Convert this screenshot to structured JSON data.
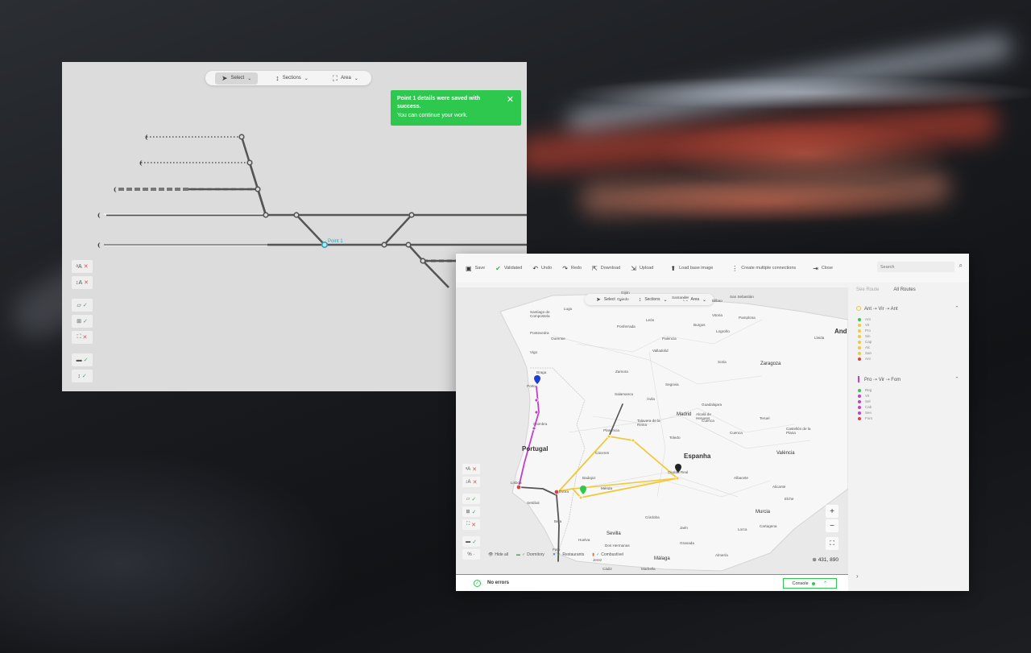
{
  "back": {
    "modes": [
      {
        "label": "Select",
        "icon": "cursor-icon"
      },
      {
        "label": "Sections",
        "icon": "section-icon"
      },
      {
        "label": "Area",
        "icon": "crop-icon"
      }
    ],
    "toast": {
      "title": "Point 1 details were saved with success.",
      "subtitle": "You can continue your work.",
      "close": "✕"
    },
    "point_label": "Point 1"
  },
  "front": {
    "toolbar": {
      "save": "Save",
      "validated": "Validated",
      "undo": "Undo",
      "redo": "Redo",
      "download": "Download",
      "upload": "Upload",
      "load_base_image": "Load base image",
      "create_multiple": "Create multiple connections",
      "close": "Close",
      "search_placeholder": "Search"
    },
    "modes": [
      {
        "label": "Select"
      },
      {
        "label": "Sections"
      },
      {
        "label": "Area"
      }
    ],
    "countries": [
      "Portugal",
      "Espanha",
      "And"
    ],
    "cities": [
      "Santiago de Compostela",
      "Lugo",
      "Ourense",
      "Pontevedra",
      "Vigo",
      "Braga",
      "Porto",
      "Coimbra",
      "Lisboa",
      "Setúbal",
      "Évora",
      "Beja",
      "Faro",
      "Badajoz",
      "Cáceres",
      "Salamanca",
      "Plasencia",
      "Madrid",
      "Toledo",
      "Ciudad Real",
      "Zamora",
      "Valladolid",
      "Palencia",
      "León",
      "Burgos",
      "Logroño",
      "Pamplona",
      "Vitoria",
      "Bilbao",
      "San Sebastián",
      "Santander",
      "Oviedo",
      "Gijón",
      "Ávila",
      "Segovia",
      "Soria",
      "Zaragoza",
      "Lleida",
      "Teruel",
      "Cuenca",
      "Guadalajara",
      "València",
      "Castellón de la Plana",
      "Albacete",
      "Alicante",
      "Murcia",
      "Cartagena",
      "Jaén",
      "Córdoba",
      "Sevilla",
      "Huelva",
      "Granada",
      "Málaga",
      "Almería",
      "Cádiz",
      "Marbella",
      "Dos Hermanas",
      "Mérida",
      "Cuenca",
      "Alcalá de Henares",
      "Talavera de la Reina",
      "Lorca",
      "Ponferrada",
      "Elche",
      "Jerez"
    ],
    "legend": {
      "hide_all": "Hide all",
      "dormitory": "Dormitory",
      "restaurants": "Restaurants",
      "combustivel": "Combustível"
    },
    "coords": "431, 890",
    "status": {
      "text": "No errors",
      "console": "Console"
    },
    "panel": {
      "tabs": [
        "See Route",
        "All Routes"
      ],
      "routes": [
        {
          "title": "Ant ⇢ Vir ⇢ Ant",
          "color": "#f0c93a",
          "stops": [
            "Ant",
            "Vir",
            "Pro",
            "Sin",
            "Cap",
            "Alc",
            "San",
            "Ant"
          ]
        },
        {
          "title": "Pro ⇢ Vir ⇢ Fom",
          "color": "#c040c8",
          "stops": [
            "Reg",
            "Vir",
            "Sel",
            "Cab",
            "Sen",
            "Fom"
          ]
        }
      ]
    },
    "colors": {
      "accent_green": "#2ec84e",
      "route_yellow": "#f0c93a",
      "route_magenta": "#c040c8",
      "route_dark": "#555555",
      "route_red": "#e04040"
    }
  }
}
